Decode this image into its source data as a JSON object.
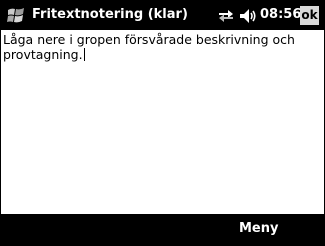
{
  "titlebar": {
    "title": "Fritextnotering (klar)",
    "clock": "08:56",
    "ok_label": "ok",
    "icons": [
      "windows-start-icon",
      "connectivity-icon",
      "volume-icon"
    ]
  },
  "note": {
    "text": "Låga nere i gropen försvårade beskrivning och provtagning."
  },
  "menubar": {
    "menu_label": "Meny"
  },
  "colors": {
    "bar_background": "#000000",
    "bar_text": "#ffffff",
    "content_background": "#ffffff",
    "ok_background": "#d9d9d9"
  }
}
